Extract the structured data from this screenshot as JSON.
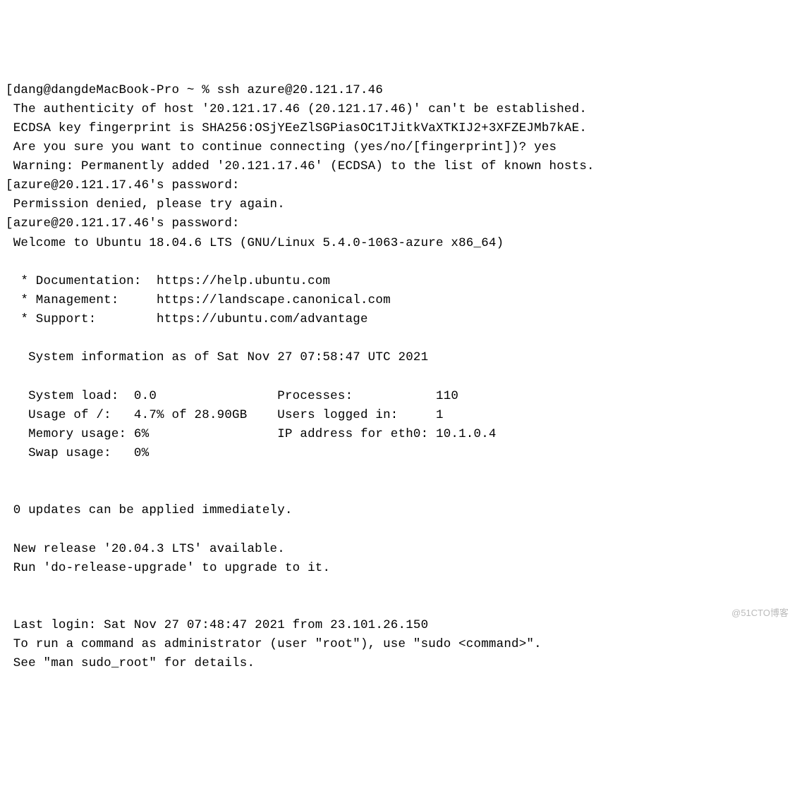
{
  "lines": {
    "l0": "[dang@dangdeMacBook-Pro ~ % ssh azure@20.121.17.46",
    "l1": " The authenticity of host '20.121.17.46 (20.121.17.46)' can't be established.",
    "l2": " ECDSA key fingerprint is SHA256:OSjYEeZlSGPiasOC1TJitkVaXTKIJ2+3XFZEJMb7kAE.",
    "l3": " Are you sure you want to continue connecting (yes/no/[fingerprint])? yes",
    "l4": " Warning: Permanently added '20.121.17.46' (ECDSA) to the list of known hosts.",
    "l5": "[azure@20.121.17.46's password:",
    "l6": " Permission denied, please try again.",
    "l7": "[azure@20.121.17.46's password:",
    "l8": " Welcome to Ubuntu 18.04.6 LTS (GNU/Linux 5.4.0-1063-azure x86_64)",
    "l9": "",
    "l10": "  * Documentation:  https://help.ubuntu.com",
    "l11": "  * Management:     https://landscape.canonical.com",
    "l12": "  * Support:        https://ubuntu.com/advantage",
    "l13": "",
    "l14": "   System information as of Sat Nov 27 07:58:47 UTC 2021",
    "l15": "",
    "l16": "   System load:  0.0                Processes:           110",
    "l17": "   Usage of /:   4.7% of 28.90GB    Users logged in:     1",
    "l18": "   Memory usage: 6%                 IP address for eth0: 10.1.0.4",
    "l19": "   Swap usage:   0%",
    "l20": "",
    "l21": "",
    "l22": " 0 updates can be applied immediately.",
    "l23": "",
    "l24": " New release '20.04.3 LTS' available.",
    "l25": " Run 'do-release-upgrade' to upgrade to it.",
    "l26": "",
    "l27": "",
    "l28": " Last login: Sat Nov 27 07:48:47 2021 from 23.101.26.150",
    "l29": " To run a command as administrator (user \"root\"), use \"sudo <command>\".",
    "l30": " See \"man sudo_root\" for details."
  },
  "watermark": "@51CTO博客"
}
